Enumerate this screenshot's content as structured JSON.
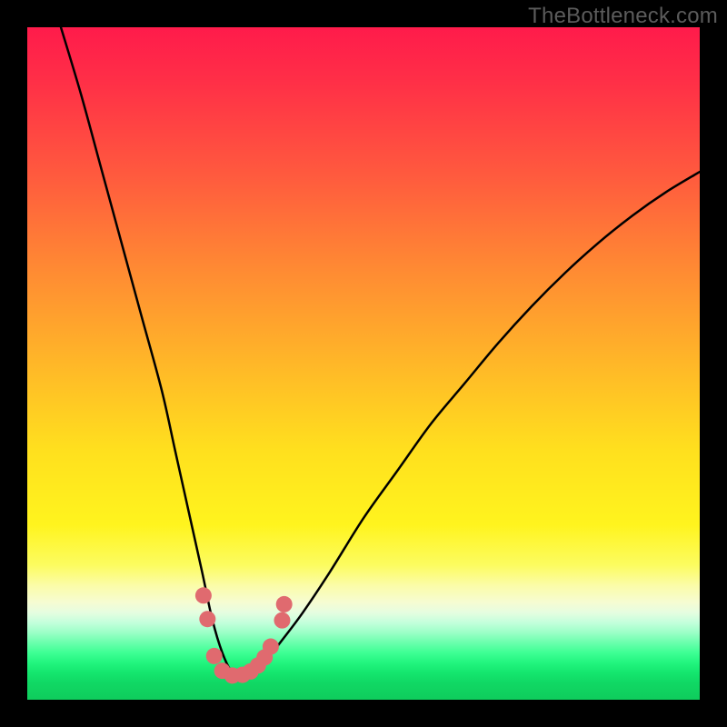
{
  "watermark": "TheBottleneck.com",
  "chart_data": {
    "type": "line",
    "title": "",
    "xlabel": "",
    "ylabel": "",
    "xlim": [
      0,
      100
    ],
    "ylim": [
      0,
      100
    ],
    "legend": false,
    "grid": false,
    "background": "red-to-green vertical gradient",
    "curve": {
      "description": "Asymmetric V-shaped bottleneck curve; steep descent from top-left, dip near x≈30, slower rise to upper-right",
      "x": [
        5,
        8,
        11,
        14,
        17,
        20,
        22,
        24,
        26,
        27.5,
        29,
        30.5,
        32,
        34,
        36,
        38,
        41,
        45,
        50,
        55,
        60,
        65,
        70,
        75,
        80,
        85,
        90,
        95,
        100
      ],
      "y": [
        100,
        90,
        79,
        68,
        57,
        46,
        37,
        28,
        19,
        12,
        7,
        4,
        3.5,
        4.5,
        6.5,
        9,
        13,
        19,
        27,
        34,
        41,
        47,
        53,
        58.5,
        63.5,
        68,
        72,
        75.5,
        78.5
      ]
    },
    "markers": {
      "description": "Salmon dots clustered around the curve minimum",
      "color": "#e06a6f",
      "points": [
        {
          "x": 26.2,
          "y": 15.5
        },
        {
          "x": 26.8,
          "y": 12.0
        },
        {
          "x": 27.8,
          "y": 6.5
        },
        {
          "x": 29.0,
          "y": 4.3
        },
        {
          "x": 30.5,
          "y": 3.6
        },
        {
          "x": 32.0,
          "y": 3.7
        },
        {
          "x": 33.2,
          "y": 4.2
        },
        {
          "x": 34.3,
          "y": 5.1
        },
        {
          "x": 35.3,
          "y": 6.3
        },
        {
          "x": 36.2,
          "y": 7.9
        },
        {
          "x": 37.9,
          "y": 11.8
        },
        {
          "x": 38.2,
          "y": 14.2
        }
      ]
    }
  }
}
